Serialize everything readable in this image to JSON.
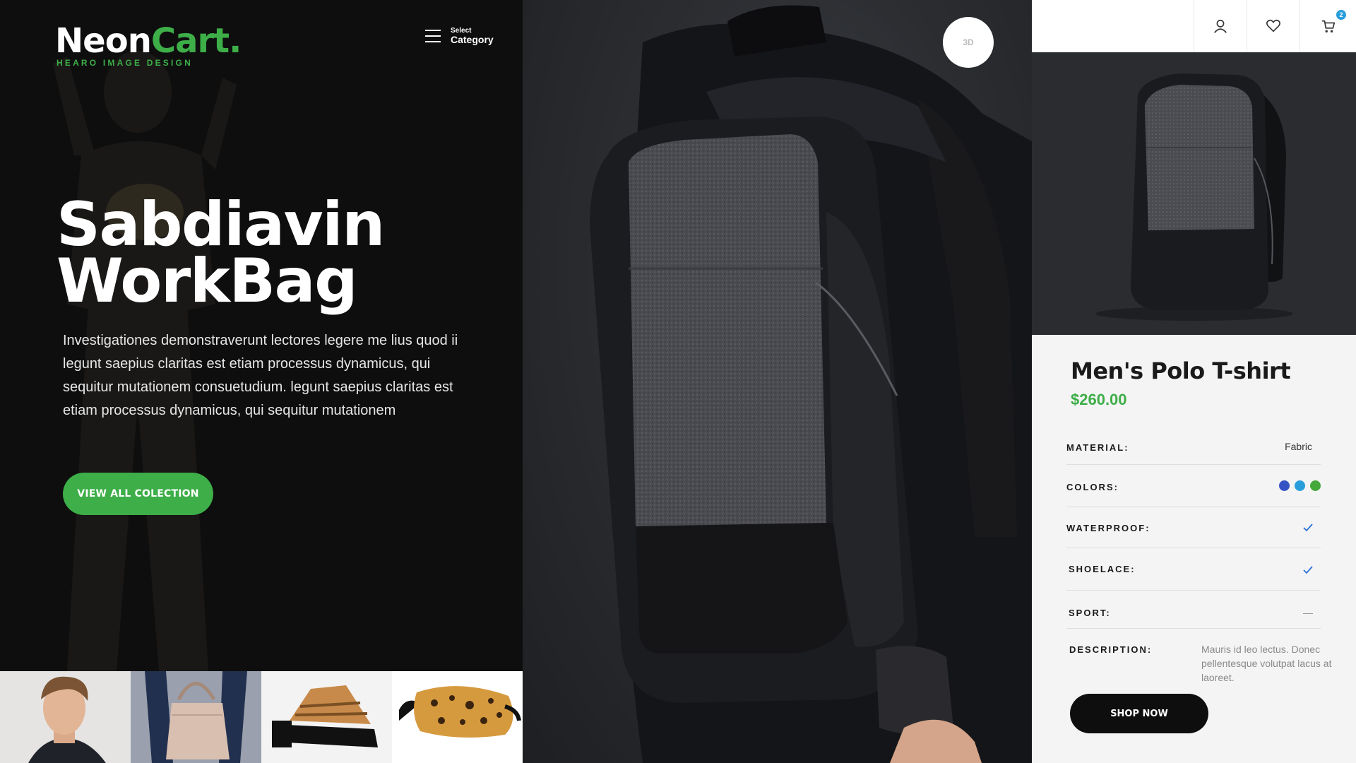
{
  "logo": {
    "neon": "Neon",
    "cart": "Cart.",
    "tagline": "HEARO IMAGE DESIGN"
  },
  "category_menu": {
    "small": "Select",
    "label": "Category"
  },
  "hero": {
    "title_line1": "Sabdiavin",
    "title_line2": "WorkBag",
    "description": "Investigationes demonstraverunt lectores legere me lius quod ii legunt saepius claritas est etiam processus dynamicus, qui sequitur mutationem consuetudium. legunt saepius claritas est etiam processus dynamicus, qui sequitur mutationem",
    "button_label": "VIEW ALL COLECTION"
  },
  "thumbnails": [
    {
      "name": "thumbnail-man-portrait"
    },
    {
      "name": "thumbnail-handbag"
    },
    {
      "name": "thumbnail-sandals"
    },
    {
      "name": "thumbnail-leopard-pouch"
    }
  ],
  "viewer": {
    "rotate_label": "3D"
  },
  "header_icons": {
    "account": "user-icon",
    "wishlist": "heart-icon",
    "cart": "cart-icon",
    "cart_count": "2"
  },
  "product": {
    "title": "Men's Polo T-shirt",
    "price": "$260.00",
    "specs": {
      "material_label": "MATERIAL:",
      "material_value": "Fabric",
      "colors_label": "COLORS:",
      "colors": [
        "#3653c4",
        "#2a9ddc",
        "#44a83a"
      ],
      "waterproof_label": "WATERPROOF:",
      "shoelace_label": "SHOELACE:",
      "sport_label": "SPORT:",
      "description_label": "DESCRIPTION:",
      "description_value": "Mauris id leo lectus. Donec pellentesque volutpat lacus at laoreet."
    },
    "shop_button": "SHOP NOW"
  },
  "colors": {
    "accent": "#3dae48",
    "dark": "#0e0e0e",
    "check": "#2a6fd6"
  }
}
